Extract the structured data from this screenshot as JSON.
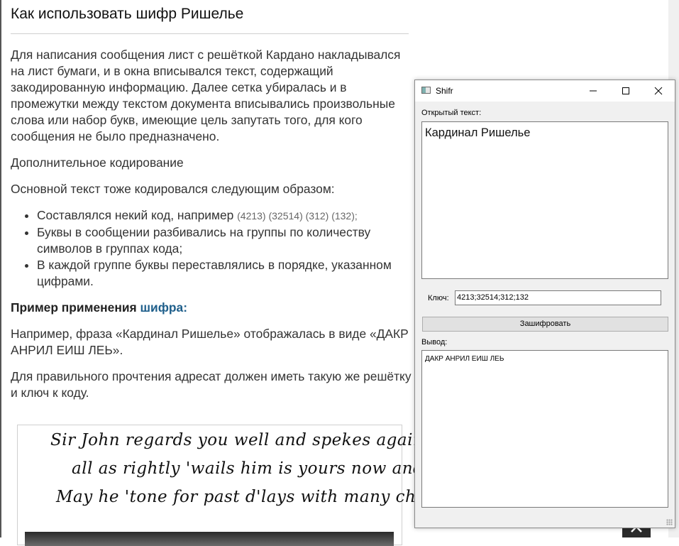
{
  "article": {
    "title": "Как использовать шифр Ришелье",
    "p1": "Для написания сообщения лист с решёткой Кардано накладывался на лист бумаги, и в окна вписывался текст, содержащий закодированную информацию. Далее сетка убиралась и в промежутки между текстом документа вписывались произвольные слова или набор букв, имеющие цель запутать того, для кого сообщения не было предназначено.",
    "p2": "Дополнительное кодирование",
    "p3": "Основной текст тоже кодировался следующим образом:",
    "list": [
      {
        "text": "Составлялся некий код, например ",
        "code": "(4213) (32514) (312) (132);"
      },
      {
        "text": "Буквы в сообщении разбивались на группы по количеству символов в группах кода;"
      },
      {
        "text": "В каждой группе буквы переставлялись в порядке, указанном цифрами."
      }
    ],
    "example_bold": "Пример применения ",
    "example_link": "шифра:",
    "p5": "Например, фраза «Кардинал Ришелье» отображалась в виде «ДАКР АНРИЛ ЕИШ ЛЕЬ».",
    "p6": "Для правильного прочтения адресат должен иметь такую же решётку и ключ к коду.",
    "letter_lines": [
      "Sir John regards you well and spekes again that",
      "all as rightly 'wails him is yours now and ever.",
      "May he 'tone for past d'lays with many charms."
    ]
  },
  "window": {
    "title": "Shifr",
    "open_text_label": "Открытый текст:",
    "open_text_value": "Кардинал Ришелье",
    "key_label": "Ключ:",
    "key_value": "4213;32514;312;132",
    "encrypt_button": "Зашифровать",
    "output_label": "Вывод:",
    "output_value": "ДАКР АНРИЛ ЕИШ ЛЕЬ"
  },
  "colors": {
    "link": "#1f5f8b",
    "window_bg": "#f0f0f0"
  }
}
